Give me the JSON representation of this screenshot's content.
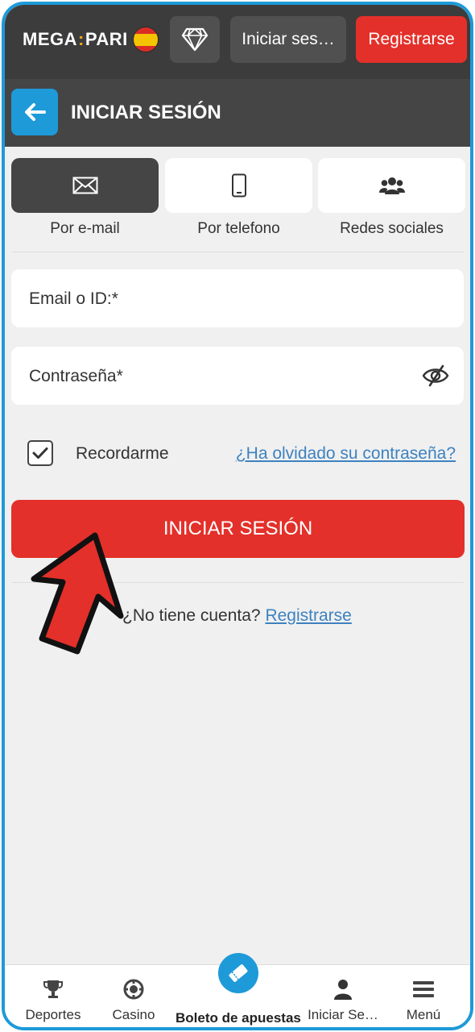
{
  "header": {
    "logo_left": "MEGA",
    "logo_colon": ":",
    "logo_right": "PARI",
    "login_label": "Iniciar ses…",
    "register_label": "Registrarse"
  },
  "page": {
    "title": "INICIAR SESIÓN"
  },
  "methods": [
    {
      "label": "Por e-mail",
      "icon": "envelope-icon",
      "active": true
    },
    {
      "label": "Por telefono",
      "icon": "phone-icon",
      "active": false
    },
    {
      "label": "Redes sociales",
      "icon": "people-icon",
      "active": false
    }
  ],
  "form": {
    "email_label": "Email o ID:*",
    "password_label": "Contraseña*",
    "remember_label": "Recordarme",
    "remember_checked": true,
    "forgot_label": "¿Ha olvidado su contraseña?",
    "submit_label": "INICIAR SESIÓN",
    "no_account_text": "¿No tiene cuenta?",
    "register_link": "Registrarse"
  },
  "bottom_nav": [
    {
      "label": "Deportes",
      "icon": "trophy-icon"
    },
    {
      "label": "Casino",
      "icon": "casino-chip-icon"
    },
    {
      "label": "Boleto de apuestas",
      "icon": "ticket-icon"
    },
    {
      "label": "Iniciar Se…",
      "icon": "user-icon",
      "active": true
    },
    {
      "label": "Menú",
      "icon": "menu-icon"
    }
  ],
  "colors": {
    "accent_blue": "#1e9ad8",
    "accent_red": "#e3302a",
    "header_dark": "#3c3c3c"
  }
}
